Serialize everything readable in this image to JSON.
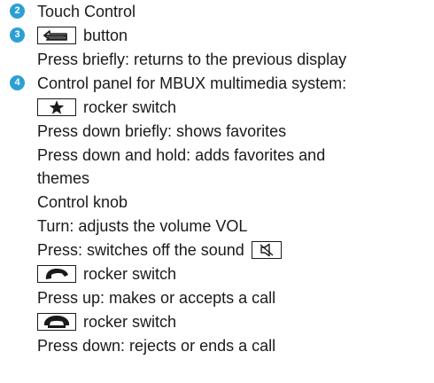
{
  "items": [
    {
      "number": "2",
      "text": "Touch Control"
    },
    {
      "number": "3",
      "button_text": "button",
      "desc": "Press briefly: returns to the previous display"
    },
    {
      "number": "4",
      "title": "Control panel for MBUX multimedia system:",
      "favorites_rocker": "rocker switch",
      "fav_press_briefly": "Press down briefly: shows favorites",
      "fav_hold_line1": "Press down and hold: adds favorites and",
      "fav_hold_line2": "themes",
      "knob_title": "Control knob",
      "knob_turn": "Turn: adjusts the volume VOL",
      "knob_press": "Press: switches off the sound",
      "call_rocker": "rocker switch",
      "call_up": "Press up: makes or accepts a call",
      "end_rocker": "rocker switch",
      "end_down": "Press down: rejects or ends a call"
    }
  ],
  "icons": {
    "back": "back-arrow-icon",
    "favorites": "star-icon",
    "mute": "mute-icon",
    "call": "phone-pickup-icon",
    "end_call": "phone-hangup-icon"
  },
  "colors": {
    "badge": "#2b9fd6",
    "text": "#1a1a1a"
  }
}
